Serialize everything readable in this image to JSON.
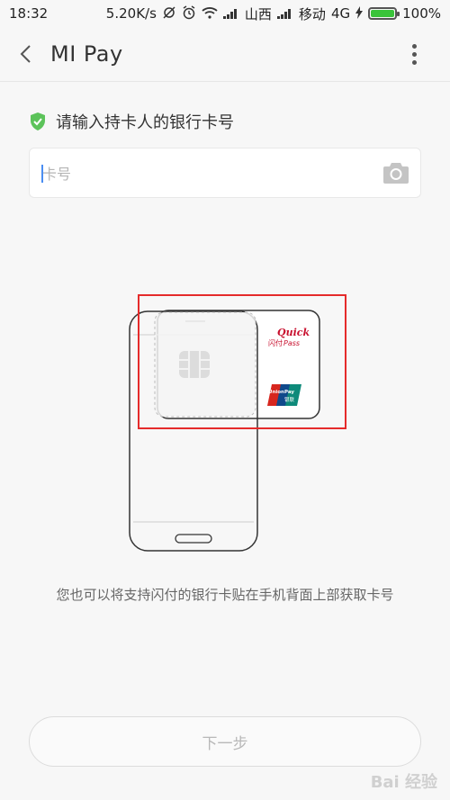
{
  "status_bar": {
    "time": "18:32",
    "speed": "5.20K/s",
    "carrier1": "山西",
    "carrier2": "移动",
    "network": "4G",
    "battery": "100%",
    "icons": [
      "sync-off-icon",
      "alarm-icon",
      "wifi-icon",
      "signal-icon",
      "signal-icon",
      "charging-icon",
      "battery-icon"
    ]
  },
  "app_bar": {
    "title": "MI Pay",
    "back_icon": "back-chevron-icon",
    "menu_icon": "more-vertical-icon"
  },
  "form": {
    "prompt": "请输入持卡人的银行卡号",
    "prompt_icon": "shield-check-icon",
    "card_number": {
      "value": "",
      "placeholder": "卡号"
    },
    "camera_icon": "camera-icon"
  },
  "illustration": {
    "quickpass_line1": "Quick",
    "quickpass_line2": "闪付",
    "quickpass_line3": "Pass",
    "unionpay_line1": "UnionPay",
    "unionpay_line2": "银联"
  },
  "hint": "您也可以将支持闪付的银行卡贴在手机背面上部获取卡号",
  "next_button": "下一步",
  "watermark": "Bai 经验",
  "colors": {
    "accent": "#4a8df2",
    "shield": "#5cc35a",
    "highlight": "#e52b2b",
    "battery": "#39c33a"
  }
}
